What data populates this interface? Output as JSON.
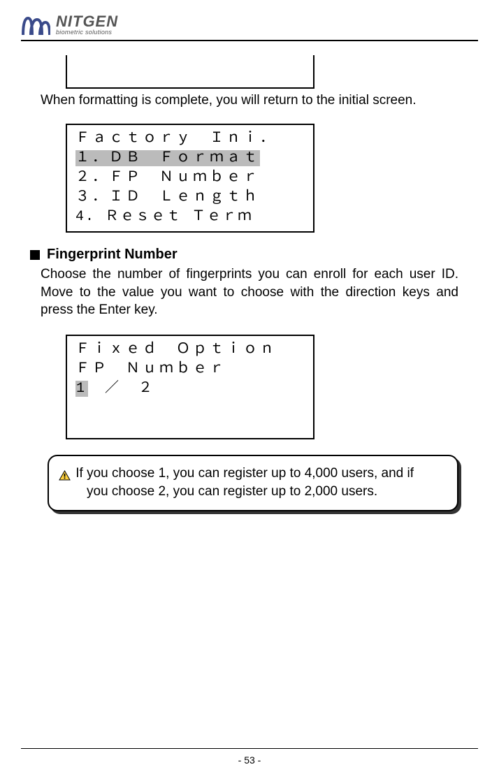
{
  "brand": {
    "name": "NITGEN",
    "tagline": "biometric solutions"
  },
  "intro": "When formatting is complete, you will return to the initial screen.",
  "menu": {
    "title": "Ｆａｃｔｏｒｙ　Ｉｎｉ．",
    "items": [
      "１．ＤＢ　Ｆｏｒｍａｔ",
      "２．ＦＰ　Ｎｕｍｂｅｒ",
      "３．ＩＤ　Ｌｅｎｇｔｈ",
      "4. Ｒｅｓｅｔ Ｔｅｒｍ"
    ]
  },
  "section": {
    "title": "Fingerprint Number",
    "body": "Choose the number of fingerprints you can enroll for each user ID. Move to the value you want to choose with the direction keys and press the Enter key."
  },
  "option": {
    "line1": "Ｆｉｘｅｄ　Ｏｐｔｉｏｎ",
    "line2": "ＦＰ　Ｎｕｍｂｅｒ",
    "selected": "1",
    "rest": "　／　２"
  },
  "note": {
    "line1": "If you choose 1, you can register up to 4,000 users, and if",
    "line2": "you choose 2, you can register up to 2,000 users."
  },
  "page": "- 53 -"
}
